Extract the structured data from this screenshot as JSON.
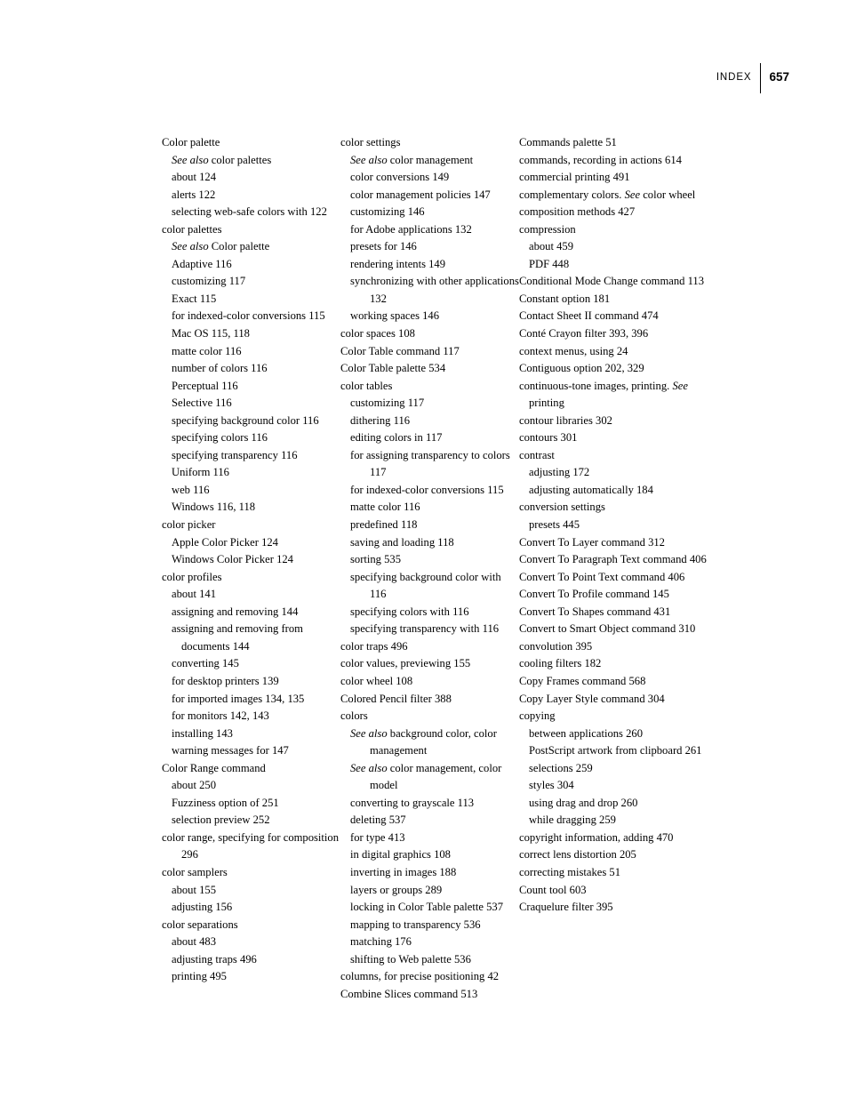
{
  "header": {
    "label": "INDEX",
    "folio": "657"
  },
  "columns": [
    {
      "name": "column-1",
      "entries": [
        {
          "level": "main",
          "text": "Color palette"
        },
        {
          "level": "sub",
          "italic": "See also",
          "text": " color palettes"
        },
        {
          "level": "sub",
          "text": "about 124"
        },
        {
          "level": "sub",
          "text": "alerts 122"
        },
        {
          "level": "sub",
          "text": "selecting web-safe colors with 122"
        },
        {
          "level": "main",
          "text": "color palettes"
        },
        {
          "level": "sub",
          "italic": "See also",
          "text": " Color palette"
        },
        {
          "level": "sub",
          "text": "Adaptive 116"
        },
        {
          "level": "sub",
          "text": "customizing 117"
        },
        {
          "level": "sub",
          "text": "Exact 115"
        },
        {
          "level": "sub",
          "text": "for indexed-color conversions 115"
        },
        {
          "level": "sub",
          "text": "Mac OS 115, 118"
        },
        {
          "level": "sub",
          "text": "matte color 116"
        },
        {
          "level": "sub",
          "text": "number of colors 116"
        },
        {
          "level": "sub",
          "text": "Perceptual 116"
        },
        {
          "level": "sub",
          "text": "Selective 116"
        },
        {
          "level": "sub",
          "text": "specifying background color 116"
        },
        {
          "level": "sub",
          "text": "specifying colors 116"
        },
        {
          "level": "sub",
          "text": "specifying transparency 116"
        },
        {
          "level": "sub",
          "text": "Uniform 116"
        },
        {
          "level": "sub",
          "text": "web 116"
        },
        {
          "level": "sub",
          "text": "Windows 116, 118"
        },
        {
          "level": "main",
          "text": "color picker"
        },
        {
          "level": "sub",
          "text": "Apple Color Picker 124"
        },
        {
          "level": "sub",
          "text": "Windows Color Picker 124"
        },
        {
          "level": "main",
          "text": "color profiles"
        },
        {
          "level": "sub",
          "text": "about 141"
        },
        {
          "level": "sub",
          "text": "assigning and removing 144"
        },
        {
          "level": "sub",
          "text": "assigning and removing from documents 144"
        },
        {
          "level": "sub",
          "text": "converting 145"
        },
        {
          "level": "sub",
          "text": "for desktop printers 139"
        },
        {
          "level": "sub",
          "text": "for imported images 134, 135"
        },
        {
          "level": "sub",
          "text": "for monitors 142, 143"
        },
        {
          "level": "sub",
          "text": "installing 143"
        },
        {
          "level": "sub",
          "text": "warning messages for 147"
        },
        {
          "level": "main",
          "text": "Color Range command"
        },
        {
          "level": "sub",
          "text": "about 250"
        },
        {
          "level": "sub",
          "text": "Fuzziness option of 251"
        },
        {
          "level": "sub",
          "text": "selection preview 252"
        },
        {
          "level": "main",
          "text": "color range, specifying for composition 296"
        },
        {
          "level": "main",
          "text": "color samplers"
        },
        {
          "level": "sub",
          "text": "about 155"
        },
        {
          "level": "sub",
          "text": "adjusting 156"
        },
        {
          "level": "main",
          "text": "color separations"
        },
        {
          "level": "sub",
          "text": "about 483"
        },
        {
          "level": "sub",
          "text": "adjusting traps 496"
        },
        {
          "level": "sub",
          "text": "printing 495"
        }
      ]
    },
    {
      "name": "column-2",
      "entries": [
        {
          "level": "main",
          "text": "color settings"
        },
        {
          "level": "sub",
          "italic": "See also",
          "text": " color management"
        },
        {
          "level": "sub",
          "text": "color conversions 149"
        },
        {
          "level": "sub",
          "text": "color management policies 147"
        },
        {
          "level": "sub",
          "text": "customizing 146"
        },
        {
          "level": "sub",
          "text": "for Adobe applications 132"
        },
        {
          "level": "sub",
          "text": "presets for 146"
        },
        {
          "level": "sub",
          "text": "rendering intents 149"
        },
        {
          "level": "sub2",
          "text": "synchronizing with other applications 132"
        },
        {
          "level": "sub",
          "text": "working spaces 146"
        },
        {
          "level": "main",
          "text": "color spaces 108"
        },
        {
          "level": "main",
          "text": "Color Table command 117"
        },
        {
          "level": "main",
          "text": "Color Table palette 534"
        },
        {
          "level": "main",
          "text": "color tables"
        },
        {
          "level": "sub",
          "text": "customizing 117"
        },
        {
          "level": "sub",
          "text": "dithering 116"
        },
        {
          "level": "sub",
          "text": "editing colors in 117"
        },
        {
          "level": "sub2",
          "text": "for assigning transparency to colors 117"
        },
        {
          "level": "sub",
          "text": "for indexed-color conversions 115"
        },
        {
          "level": "sub",
          "text": "matte color 116"
        },
        {
          "level": "sub",
          "text": "predefined 118"
        },
        {
          "level": "sub",
          "text": "saving and loading 118"
        },
        {
          "level": "sub",
          "text": "sorting 535"
        },
        {
          "level": "sub2",
          "text": "specifying background color with 116"
        },
        {
          "level": "sub",
          "text": "specifying colors with 116"
        },
        {
          "level": "sub",
          "text": "specifying transparency with 116"
        },
        {
          "level": "main",
          "text": "color traps 496"
        },
        {
          "level": "main",
          "text": "color values, previewing 155"
        },
        {
          "level": "main",
          "text": "color wheel 108"
        },
        {
          "level": "main",
          "text": "Colored Pencil filter 388"
        },
        {
          "level": "main",
          "text": "colors"
        },
        {
          "level": "sub2",
          "italic": "See also",
          "text": " background color, color management"
        },
        {
          "level": "sub2",
          "italic": "See also",
          "text": " color management, color model"
        },
        {
          "level": "sub",
          "text": "converting to grayscale 113"
        },
        {
          "level": "sub",
          "text": "deleting 537"
        },
        {
          "level": "sub",
          "text": "for type 413"
        },
        {
          "level": "sub",
          "text": "in digital graphics 108"
        },
        {
          "level": "sub",
          "text": "inverting in images 188"
        },
        {
          "level": "sub",
          "text": "layers or groups 289"
        },
        {
          "level": "sub",
          "text": "locking in Color Table palette 537"
        },
        {
          "level": "sub",
          "text": "mapping to transparency 536"
        },
        {
          "level": "sub",
          "text": "matching 176"
        },
        {
          "level": "sub",
          "text": "shifting to Web palette 536"
        },
        {
          "level": "main",
          "text": "columns, for precise positioning 42"
        },
        {
          "level": "main",
          "text": "Combine Slices command 513"
        }
      ]
    },
    {
      "name": "column-3",
      "entries": [
        {
          "level": "main",
          "text": "Commands palette 51"
        },
        {
          "level": "main",
          "text": "commands, recording in actions 614"
        },
        {
          "level": "main",
          "text": "commercial printing 491"
        },
        {
          "level": "main-hang11",
          "text": "complementary colors. ",
          "italic_mid": "See",
          "text_tail": " color wheel"
        },
        {
          "level": "main",
          "text": "composition methods 427"
        },
        {
          "level": "main",
          "text": "compression"
        },
        {
          "level": "sub",
          "text": "about 459"
        },
        {
          "level": "sub",
          "text": "PDF 448"
        },
        {
          "level": "main",
          "text": "Conditional Mode Change command 113"
        },
        {
          "level": "main",
          "text": "Constant option 181"
        },
        {
          "level": "main",
          "text": "Contact Sheet II command 474"
        },
        {
          "level": "main",
          "text": "Conté Crayon filter 393, 396"
        },
        {
          "level": "main",
          "text": "context menus, using 24"
        },
        {
          "level": "main",
          "text": "Contiguous option 202, 329"
        },
        {
          "level": "main-hang11",
          "text": "continuous-tone images, printing. ",
          "italic_mid": "See",
          "text_tail": " printing"
        },
        {
          "level": "main",
          "text": "contour libraries 302"
        },
        {
          "level": "main",
          "text": "contours 301"
        },
        {
          "level": "main",
          "text": "contrast"
        },
        {
          "level": "sub",
          "text": "adjusting 172"
        },
        {
          "level": "sub",
          "text": "adjusting automatically 184"
        },
        {
          "level": "main",
          "text": "conversion settings"
        },
        {
          "level": "sub",
          "text": "presets 445"
        },
        {
          "level": "main",
          "text": "Convert To Layer command 312"
        },
        {
          "level": "main",
          "text": "Convert To Paragraph Text command 406"
        },
        {
          "level": "main",
          "text": "Convert To Point Text command 406"
        },
        {
          "level": "main",
          "text": "Convert To Profile command 145"
        },
        {
          "level": "main",
          "text": "Convert To Shapes command 431"
        },
        {
          "level": "main",
          "text": "Convert to Smart Object command 310"
        },
        {
          "level": "main",
          "text": "convolution 395"
        },
        {
          "level": "main",
          "text": "cooling filters 182"
        },
        {
          "level": "main",
          "text": "Copy Frames command 568"
        },
        {
          "level": "main",
          "text": "Copy Layer Style command 304"
        },
        {
          "level": "main",
          "text": "copying"
        },
        {
          "level": "sub",
          "text": "between applications 260"
        },
        {
          "level": "sub2",
          "text": "PostScript artwork from clipboard 261"
        },
        {
          "level": "sub",
          "text": "selections 259"
        },
        {
          "level": "sub",
          "text": "styles 304"
        },
        {
          "level": "sub",
          "text": "using drag and drop 260"
        },
        {
          "level": "sub",
          "text": "while dragging 259"
        },
        {
          "level": "main",
          "text": "copyright information, adding 470"
        },
        {
          "level": "main",
          "text": "correct lens distortion 205"
        },
        {
          "level": "main",
          "text": "correcting mistakes 51"
        },
        {
          "level": "main",
          "text": "Count tool 603"
        },
        {
          "level": "main",
          "text": "Craquelure filter 395"
        }
      ]
    }
  ]
}
